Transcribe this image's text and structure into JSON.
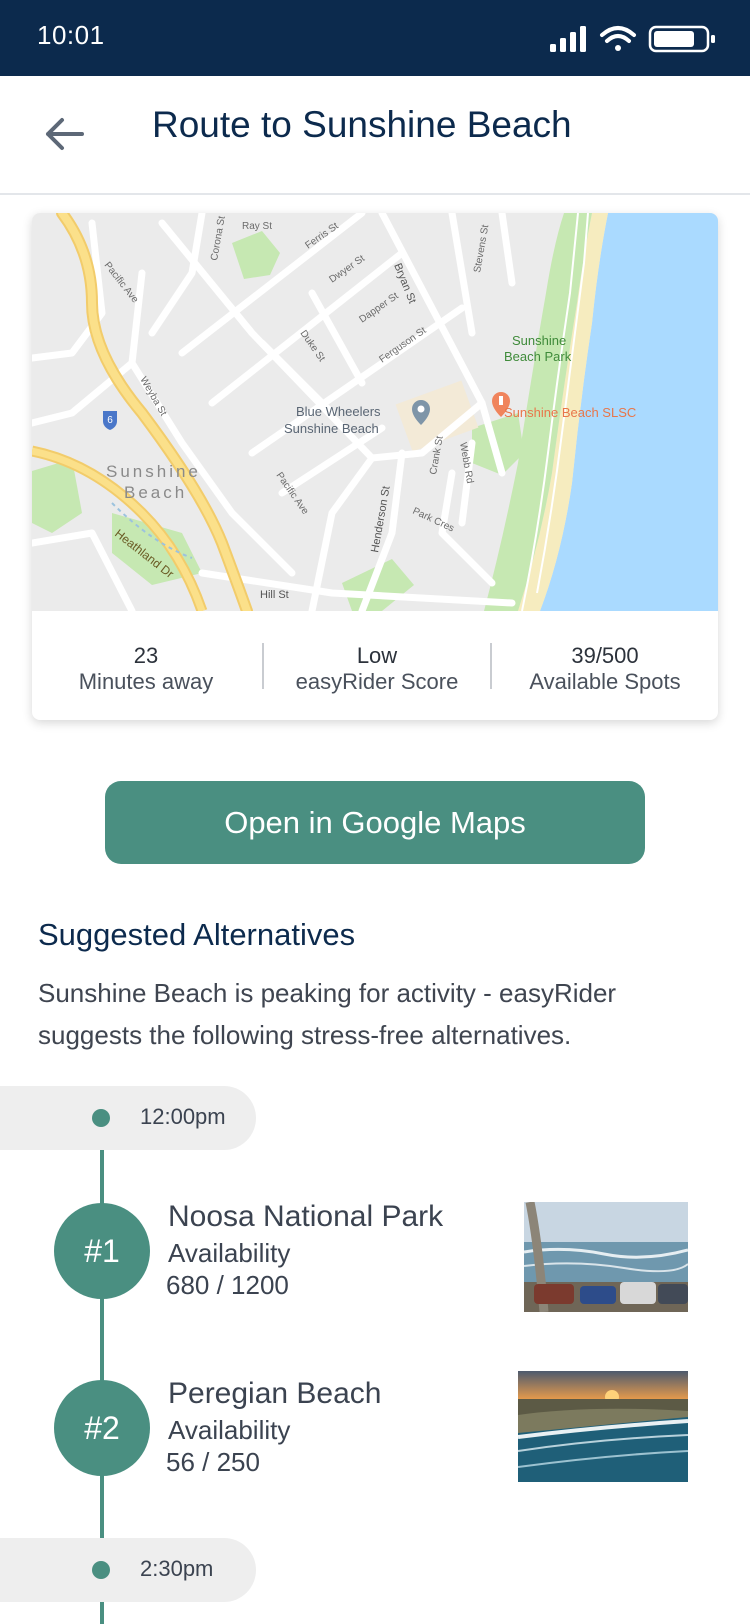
{
  "status_bar": {
    "time": "10:01"
  },
  "header": {
    "title": "Route to Sunshine Beach"
  },
  "map": {
    "labels": {
      "sunshine_beach": "Sunshine\nBeach",
      "sunshine_beach_park": "Sunshine Beach Park",
      "blue_wheelers": "Blue Wheelers Sunshine Beach",
      "slsc": "Sunshine Beach SLSC",
      "hill_st": "Hill St",
      "heathland_dr": "Heathland Dr",
      "henderson_st": "Henderson St",
      "bryan_st": "Bryan St",
      "pacific_ave": "Pacific Ave",
      "weyba_st": "Weyba St",
      "ferris_st": "Ferris St",
      "ray_st": "Ray St",
      "dwyer_st": "Dwyer St",
      "dapper_st": "Dapper St",
      "duke_st": "Duke St",
      "ferguson_st": "Ferguson St",
      "crank_st": "Crank St",
      "webb_rd": "Webb Rd",
      "park_cres": "Park Cres",
      "corona_st": "Corona St",
      "stevens_st": "Stevens St",
      "highway_number": "6"
    }
  },
  "stats": [
    {
      "value": "23",
      "label": "Minutes away"
    },
    {
      "value": "Low",
      "label": "easyRider Score"
    },
    {
      "value": "39/500",
      "label": "Available Spots"
    }
  ],
  "maps_button": {
    "label": "Open in Google Maps"
  },
  "alternatives": {
    "title": "Suggested Alternatives",
    "description": "Sunshine Beach is peaking for activity - easyRider suggests the following stress-free alternatives.",
    "times": [
      "12:00pm",
      "2:30pm"
    ],
    "items": [
      {
        "rank": "#1",
        "name": "Noosa National Park",
        "availability_label": "Availability",
        "availability": "680 / 1200"
      },
      {
        "rank": "#2",
        "name": "Peregian Beach",
        "availability_label": "Availability",
        "availability": "56 / 250"
      }
    ]
  },
  "colors": {
    "navy": "#0c2a4d",
    "accent_green": "#4a8f81",
    "map_water": "#aadaff",
    "map_park": "#c6e8b2",
    "map_highway": "#fbe08a"
  }
}
